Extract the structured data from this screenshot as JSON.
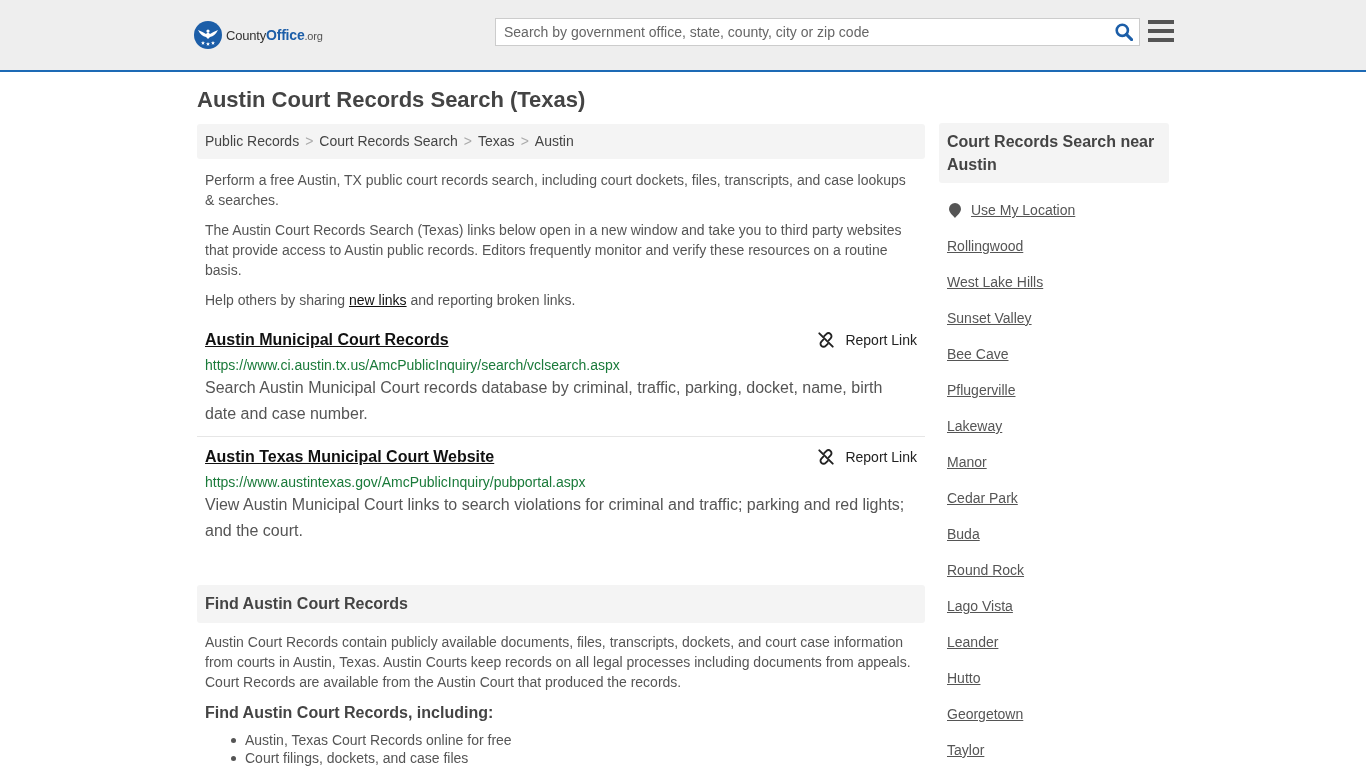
{
  "header": {
    "logo_text": [
      "County",
      "Office",
      ".org"
    ],
    "search": {
      "placeholder": "Search by government office, state, county, city or zip code"
    }
  },
  "page_title": "Austin Court Records Search (Texas)",
  "breadcrumbs": [
    {
      "label": "Public Records"
    },
    {
      "label": "Court Records Search"
    },
    {
      "label": "Texas"
    },
    {
      "label": "Austin"
    }
  ],
  "breadcrumb_separators": [
    ">",
    ">",
    ">"
  ],
  "intro": {
    "paragraphs": [
      "Perform a free Austin, TX public court records search, including court dockets, files, transcripts, and case lookups & searches.",
      "The Austin Court Records Search (Texas) links below open in a new window and take you to third party websites that provide access to Austin public records. Editors frequently monitor and verify these resources on a routine basis."
    ],
    "share_note": {
      "before": "Help others by sharing",
      "link": "new links",
      "after": "and reporting broken links."
    }
  },
  "resources": [
    {
      "title": "Austin Municipal Court Records",
      "url": "https://www.ci.austin.tx.us/AmcPublicInquiry/search/vclsearch.aspx",
      "description": "Search Austin Municipal Court records database by criminal, traffic, parking, docket, name, birth date and case number.",
      "report_label": "Report Link"
    },
    {
      "title": "Austin Texas Municipal Court Website",
      "url": "https://www.austintexas.gov/AmcPublicInquiry/pubportal.aspx",
      "description": "View Austin Municipal Court links to search violations for criminal and traffic; parking and red lights; and the court.",
      "report_label": "Report Link"
    }
  ],
  "find_section": {
    "heading": "Find Austin Court Records",
    "paragraph": "Austin Court Records contain publicly available documents, files, transcripts, dockets, and court case information from courts in Austin, Texas. Austin Courts keep records on all legal processes including documents from appeals. Court Records are available from the Austin Court that produced the records.",
    "subheading": "Find Austin Court Records, including:",
    "items": [
      "Austin, Texas Court Records online for free",
      "Court filings, dockets, and case files"
    ]
  },
  "sidebar": {
    "heading": "Court Records Search near Austin",
    "location_link": "Use My Location",
    "places": [
      "Rollingwood",
      "West Lake Hills",
      "Sunset Valley",
      "Bee Cave",
      "Pflugerville",
      "Lakeway",
      "Manor",
      "Cedar Park",
      "Buda",
      "Round Rock",
      "Lago Vista",
      "Leander",
      "Hutto",
      "Georgetown",
      "Taylor"
    ]
  }
}
